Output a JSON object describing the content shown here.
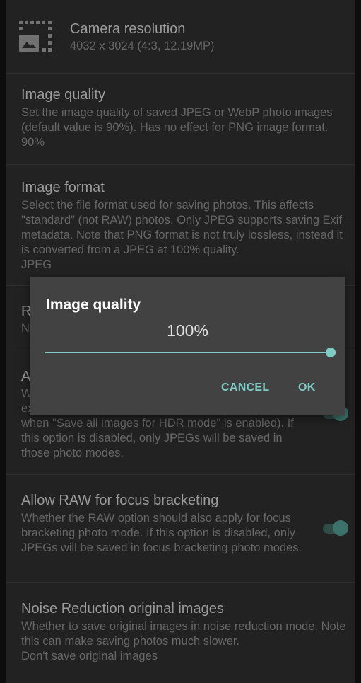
{
  "settings": {
    "camera_resolution": {
      "title": "Camera resolution",
      "value": "4032 x 3024 (4:3, 12.19MP)",
      "icon": "image-resolution-icon"
    },
    "image_quality": {
      "title": "Image quality",
      "summary": "Set the image quality of saved JPEG or WebP photo images (default value is 90%). Has no effect for PNG image format.",
      "value": "90%"
    },
    "image_format": {
      "title": "Image format",
      "summary": "Select the file format used for saving photos. This affects \"standard\" (not RAW) photos. Only JPEG supports saving Exif metadata. Note that PNG format is not truly lossless, instead it is converted from a JPEG at 100% quality.",
      "value": "JPEG"
    },
    "raw_partial": {
      "title_initial": "R",
      "value_initial": "N"
    },
    "allow_raw_expo_partial": {
      "title_initial": "A",
      "summary_line1_initial": "W",
      "summary_line2_initial": "ex",
      "summary_visible": "when \"Save all images for HDR mode\" is enabled). If this option is disabled, only JPEGs will be saved in those photo modes.",
      "toggle_on": true
    },
    "allow_raw_focus": {
      "title": "Allow RAW for focus bracketing",
      "summary": "Whether the RAW option should also apply for focus bracketing photo mode. If this option is disabled, only JPEGs will be saved in focus bracketing photo modes.",
      "toggle_on": true
    },
    "noise_reduction": {
      "title": "Noise Reduction original images",
      "summary": "Whether to save original images in noise reduction mode. Note this can make saving photos much slower.",
      "value": "Don't save original images"
    }
  },
  "dialog": {
    "title": "Image quality",
    "value_text": "100%",
    "slider_fraction": 1.0,
    "cancel_label": "CANCEL",
    "ok_label": "OK"
  },
  "colors": {
    "accent": "#80cbc4",
    "background": "#2a2a2a",
    "dialog_bg": "#424242"
  }
}
